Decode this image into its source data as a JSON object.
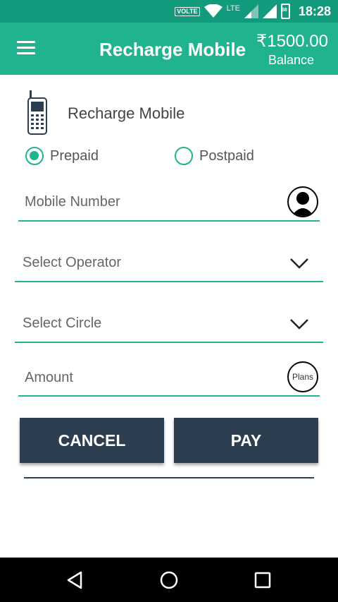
{
  "status_bar": {
    "volte_label": "VOLTE",
    "network_label": "LTE",
    "battery_level": "58",
    "time": "18:28",
    "icons": [
      "wifi-icon",
      "signal-icon",
      "battery-icon"
    ]
  },
  "app_bar": {
    "title": "Recharge Mobile",
    "balance_amount": "₹1500.00",
    "balance_label": "Balance",
    "color": "#20b38f",
    "status_color": "#129a7c"
  },
  "form": {
    "header_title": "Recharge Mobile",
    "connection_types": [
      {
        "label": "Prepaid",
        "selected": true
      },
      {
        "label": "Postpaid",
        "selected": false
      }
    ],
    "mobile_number": {
      "placeholder": "Mobile Number",
      "value": ""
    },
    "operator": {
      "placeholder": "Select Operator",
      "value": ""
    },
    "circle": {
      "placeholder": "Select Circle",
      "value": ""
    },
    "amount": {
      "placeholder": "Amount",
      "value": ""
    },
    "plans_label": "Plans"
  },
  "buttons": {
    "cancel": "CANCEL",
    "pay": "PAY",
    "color": "#2c3e50"
  },
  "nav_bar": {
    "icons": [
      "back-icon",
      "home-icon",
      "recents-icon"
    ]
  }
}
